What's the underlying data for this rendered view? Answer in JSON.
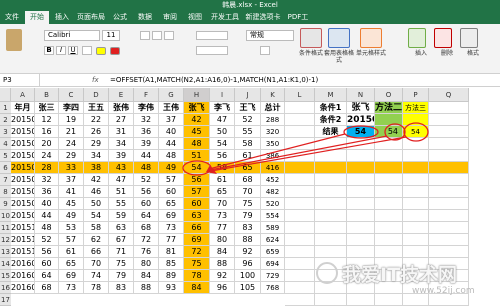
{
  "title_bar": {
    "title": "韩晨.xlsx - Excel"
  },
  "ribbon_tabs": [
    "文件",
    "开始",
    "插入",
    "页面布局",
    "公式",
    "数据",
    "审阅",
    "视图",
    "开发工具",
    "新建选项卡",
    "PDF工"
  ],
  "active_tab": "开始",
  "ribbon": {
    "font_name": "Calibri",
    "font_size": "11",
    "format_value": "常规",
    "groups": [
      "条件格式",
      "套用表格格式",
      "单元格样式",
      "插入",
      "删除",
      "格式"
    ]
  },
  "formula_bar": {
    "name_box": "P3",
    "formula": "=OFFSET(A1,MATCH(N2,A1:A16,0)-1,MATCH(N1,A1:K1,0)-1)"
  },
  "sheet": {
    "columns": [
      "A",
      "B",
      "C",
      "D",
      "E",
      "F",
      "G",
      "H",
      "I",
      "J",
      "K",
      "L",
      "M",
      "N",
      "O",
      "P",
      "Q"
    ],
    "row_numbers": [
      "1",
      "2",
      "3",
      "4",
      "5",
      "6",
      "7",
      "8",
      "9",
      "10",
      "11",
      "12",
      "13",
      "14",
      "15",
      "16",
      "17"
    ],
    "header_row": [
      "年月",
      "张三",
      "李四",
      "王五",
      "张伟",
      "李伟",
      "王伟",
      "张飞",
      "李飞",
      "王飞",
      "总计"
    ],
    "rows": [
      [
        "201501",
        "12",
        "19",
        "22",
        "27",
        "32",
        "37",
        "42",
        "47",
        "52",
        "288"
      ],
      [
        "201502",
        "16",
        "21",
        "26",
        "31",
        "36",
        "40",
        "45",
        "50",
        "55",
        "320"
      ],
      [
        "201503",
        "20",
        "24",
        "29",
        "34",
        "39",
        "44",
        "48",
        "54",
        "58",
        "350"
      ],
      [
        "201504",
        "24",
        "29",
        "34",
        "39",
        "44",
        "48",
        "51",
        "56",
        "61",
        "386"
      ],
      [
        "201505",
        "28",
        "33",
        "38",
        "43",
        "48",
        "49",
        "54",
        "58",
        "65",
        "416"
      ],
      [
        "201506",
        "32",
        "37",
        "42",
        "47",
        "52",
        "57",
        "56",
        "61",
        "68",
        "452"
      ],
      [
        "201507",
        "36",
        "41",
        "46",
        "51",
        "56",
        "60",
        "57",
        "65",
        "70",
        "482"
      ],
      [
        "201508",
        "40",
        "45",
        "50",
        "55",
        "60",
        "65",
        "60",
        "70",
        "75",
        "520"
      ],
      [
        "201509",
        "44",
        "49",
        "54",
        "59",
        "64",
        "69",
        "63",
        "73",
        "79",
        "554"
      ],
      [
        "201510",
        "48",
        "53",
        "58",
        "63",
        "68",
        "73",
        "66",
        "77",
        "83",
        "589"
      ],
      [
        "201511",
        "52",
        "57",
        "62",
        "67",
        "72",
        "77",
        "69",
        "80",
        "88",
        "624"
      ],
      [
        "201512",
        "56",
        "61",
        "66",
        "71",
        "76",
        "81",
        "72",
        "84",
        "92",
        "659"
      ],
      [
        "201601",
        "60",
        "65",
        "70",
        "75",
        "80",
        "85",
        "75",
        "88",
        "96",
        "694"
      ],
      [
        "201602",
        "64",
        "69",
        "74",
        "79",
        "84",
        "89",
        "78",
        "92",
        "100",
        "729"
      ],
      [
        "201603",
        "68",
        "73",
        "78",
        "83",
        "88",
        "93",
        "84",
        "96",
        "105",
        "768"
      ]
    ],
    "lookup": {
      "cond1_label": "条件1",
      "cond1_value": "张飞",
      "cond2_label": "条件2",
      "cond2_value": "201505",
      "result_label": "结果",
      "result_value": "54",
      "method2_label": "方法二",
      "method2_value": "54",
      "method3_label": "方法三",
      "method3_value": "54"
    }
  },
  "watermark": {
    "text": "我爱IT技术网",
    "url": "www.52ij.com"
  },
  "colors": {
    "excel_green": "#217346",
    "highlight_orange": "#ffc000",
    "lookup_blue": "#00b0f0",
    "method_green": "#92d050",
    "method_yellow": "#ffff00",
    "annotation_red": "#e02020"
  }
}
